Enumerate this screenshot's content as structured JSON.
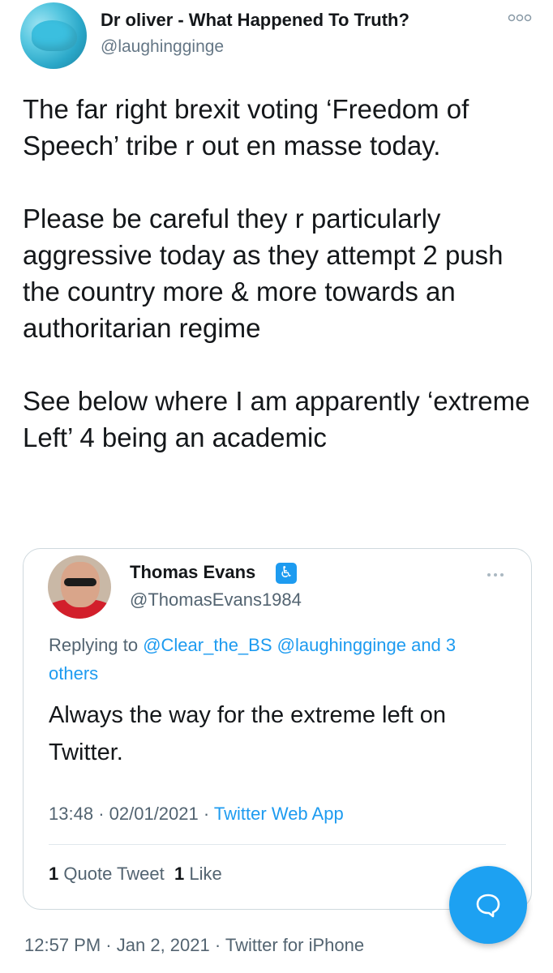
{
  "author": {
    "name": "Dr oliver - What Happened To Truth?",
    "handle": "@laughingginge"
  },
  "tweet": {
    "text": "The far right brexit voting ‘Freedom of Speech’ tribe r out en masse today.\n\nPlease be careful they r particularly aggressive today as they attempt 2 push the country more & more towards an authoritarian regime\n\nSee below where I am apparently ‘extreme Left’ 4 being an academic",
    "time": "12:57 PM",
    "date": "Jan 2, 2021",
    "source": "Twitter for iPhone"
  },
  "quoted": {
    "name": "Thomas Evans",
    "badge_icon": "accessibility-icon",
    "handle": "@ThomasEvans1984",
    "replying_prefix": "Replying to",
    "replying_links": "@Clear_the_BS @laughingginge and 3 others",
    "text": "Always the way for the extreme left on Twitter.",
    "time": "13:48",
    "date": "02/01/2021",
    "source": "Twitter Web App",
    "quote_count": "1",
    "quote_label": "Quote Tweet",
    "like_count": "1",
    "like_label": "Like"
  },
  "separator": "·",
  "colors": {
    "accent": "#1d9bf0",
    "secondary_text": "#536471",
    "border": "#cfd9de"
  }
}
